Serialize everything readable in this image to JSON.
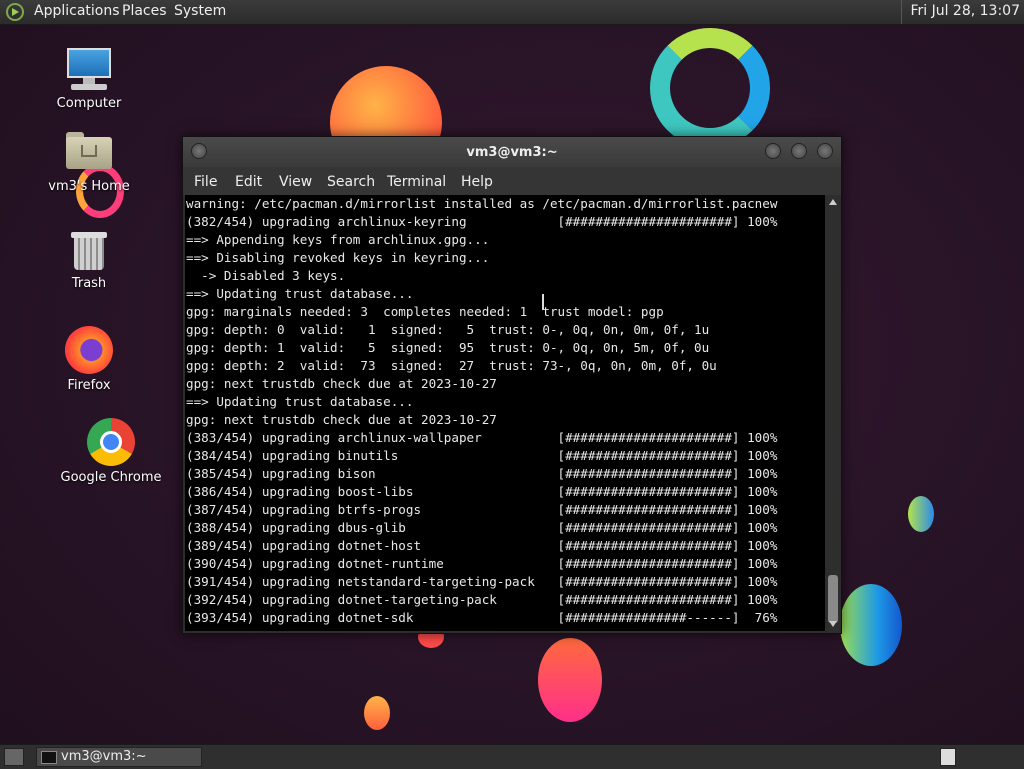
{
  "top_panel": {
    "menus": [
      "Applications",
      "Places",
      "System"
    ],
    "clock": "Fri Jul 28, 13:07"
  },
  "desktop_icons": [
    {
      "label": "Computer",
      "icon": "computer-icon"
    },
    {
      "label": "vm3's Home",
      "icon": "home-folder-icon"
    },
    {
      "label": "Trash",
      "icon": "trash-icon"
    },
    {
      "label": "Firefox",
      "icon": "firefox-icon"
    },
    {
      "label": "Google Chrome",
      "icon": "chrome-icon"
    }
  ],
  "terminal": {
    "title": "vm3@vm3:~",
    "menu": [
      "File",
      "Edit",
      "View",
      "Search",
      "Terminal",
      "Help"
    ],
    "lines": [
      "warning: /etc/pacman.d/mirrorlist installed as /etc/pacman.d/mirrorlist.pacnew",
      "(382/454) upgrading archlinux-keyring            [######################] 100%",
      "==> Appending keys from archlinux.gpg...",
      "==> Disabling revoked keys in keyring...",
      "  -> Disabled 3 keys.",
      "==> Updating trust database...",
      "gpg: marginals needed: 3  completes needed: 1  trust model: pgp",
      "gpg: depth: 0  valid:   1  signed:   5  trust: 0-, 0q, 0n, 0m, 0f, 1u",
      "gpg: depth: 1  valid:   5  signed:  95  trust: 0-, 0q, 0n, 5m, 0f, 0u",
      "gpg: depth: 2  valid:  73  signed:  27  trust: 73-, 0q, 0n, 0m, 0f, 0u",
      "gpg: next trustdb check due at 2023-10-27",
      "==> Updating trust database...",
      "gpg: next trustdb check due at 2023-10-27",
      "(383/454) upgrading archlinux-wallpaper          [######################] 100%",
      "(384/454) upgrading binutils                     [######################] 100%",
      "(385/454) upgrading bison                        [######################] 100%",
      "(386/454) upgrading boost-libs                   [######################] 100%",
      "(387/454) upgrading btrfs-progs                  [######################] 100%",
      "(388/454) upgrading dbus-glib                    [######################] 100%",
      "(389/454) upgrading dotnet-host                  [######################] 100%",
      "(390/454) upgrading dotnet-runtime               [######################] 100%",
      "(391/454) upgrading netstandard-targeting-pack   [######################] 100%",
      "(392/454) upgrading dotnet-targeting-pack        [######################] 100%",
      "(393/454) upgrading dotnet-sdk                   [################------]  76%"
    ]
  },
  "taskbar": {
    "window_label": "vm3@vm3:~"
  }
}
